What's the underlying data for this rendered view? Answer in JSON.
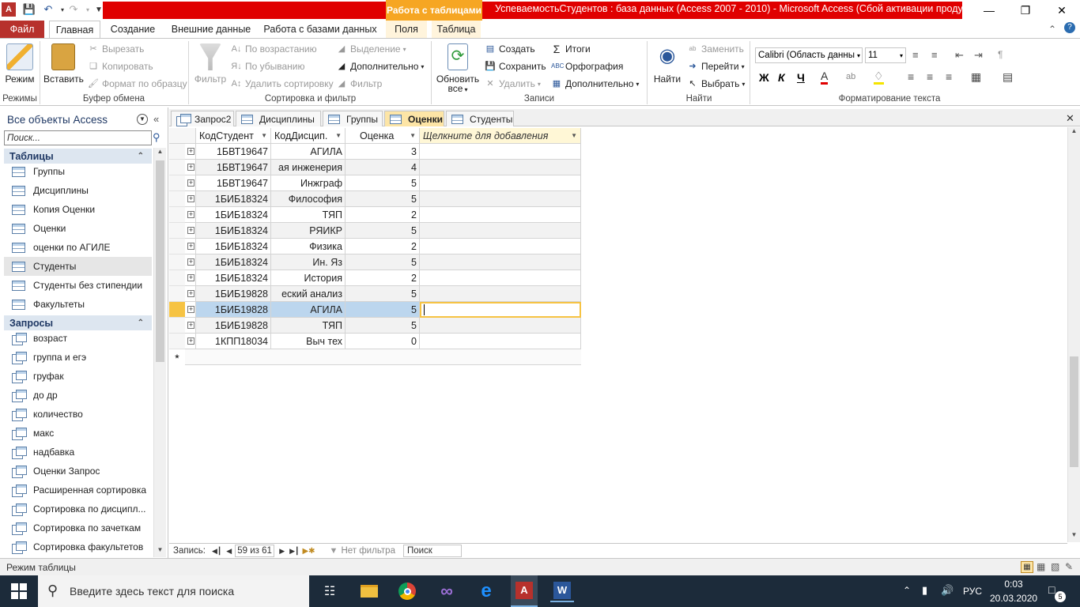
{
  "title_bar": {
    "context_tab": "Работа с таблицами",
    "window_title": "УспеваемостьСтудентов : база данных (Access 2007 - 2010)  -  Microsoft Access (Сбой активации продукта)"
  },
  "ribbon_tabs": [
    "Файл",
    "Главная",
    "Создание",
    "Внешние данные",
    "Работа с базами данных",
    "Поля",
    "Таблица"
  ],
  "ribbon": {
    "views": {
      "label": "Режимы",
      "view": "Режим"
    },
    "clipboard": {
      "label": "Буфер обмена",
      "paste": "Вставить",
      "cut": "Вырезать",
      "copy": "Копировать",
      "format_painter": "Формат по образцу"
    },
    "sort_filter": {
      "label": "Сортировка и фильтр",
      "filter": "Фильтр",
      "ascending": "По возрастанию",
      "descending": "По убыванию",
      "remove_sort": "Удалить сортировку",
      "selection": "Выделение",
      "advanced": "Дополнительно",
      "toggle_filter": "Фильтр"
    },
    "records": {
      "label": "Записи",
      "refresh": "Обновить",
      "refresh2": "все",
      "new": "Создать",
      "save": "Сохранить",
      "delete": "Удалить",
      "totals": "Итоги",
      "spelling": "Орфография",
      "more": "Дополнительно"
    },
    "find": {
      "label": "Найти",
      "find": "Найти",
      "replace": "Заменить",
      "goto": "Перейти",
      "select": "Выбрать"
    },
    "text_format": {
      "label": "Форматирование текста",
      "font": "Calibri (Область данны",
      "size": "11",
      "bold": "Ж",
      "italic": "К",
      "underline": "Ч"
    }
  },
  "nav_pane": {
    "header": "Все объекты Access",
    "search_placeholder": "Поиск...",
    "tables_label": "Таблицы",
    "tables": [
      "Группы",
      "Дисциплины",
      "Копия Оценки",
      "Оценки",
      "оценки по АГИЛЕ",
      "Студенты",
      "Студенты без стипендии",
      "Факультеты"
    ],
    "queries_label": "Запросы",
    "queries": [
      "возраст",
      "группа и егэ",
      "груфак",
      "до др",
      "количество",
      "макс",
      "надбавка",
      "Оценки Запрос",
      "Расширенная сортировка",
      "Сортировка по дисципл...",
      "Сортировка по зачеткам",
      "Сортировка факультетов"
    ]
  },
  "doc_tabs": [
    "Запрос2",
    "Дисциплины",
    "Группы",
    "Оценки",
    "Студенты"
  ],
  "datasheet": {
    "columns": [
      "КодСтудент",
      "КодДисцип.",
      "Оценка",
      "Щелкните для добавления"
    ],
    "rows": [
      [
        "1БВТ19647",
        "АГИЛА",
        "3"
      ],
      [
        "1БВТ19647",
        "ая инженерия",
        "4"
      ],
      [
        "1БВТ19647",
        "Инжграф",
        "5"
      ],
      [
        "1БИБ18324",
        "Философия",
        "5"
      ],
      [
        "1БИБ18324",
        "ТЯП",
        "2"
      ],
      [
        "1БИБ18324",
        "РЯИКР",
        "5"
      ],
      [
        "1БИБ18324",
        "Физика",
        "2"
      ],
      [
        "1БИБ18324",
        "Ин. Яз",
        "5"
      ],
      [
        "1БИБ18324",
        "История",
        "2"
      ],
      [
        "1БИБ19828",
        "еский анализ",
        "5"
      ],
      [
        "1БИБ19828",
        "АГИЛА",
        "5"
      ],
      [
        "1БИБ19828",
        "ТЯП",
        "5"
      ],
      [
        "1КПП18034",
        "Выч тех",
        "0"
      ]
    ],
    "new_row_marker": "*"
  },
  "record_nav": {
    "label": "Запись:",
    "position": "59 из 61",
    "filter": "Нет фильтра",
    "search": "Поиск"
  },
  "status_bar": {
    "mode": "Режим таблицы"
  },
  "taskbar": {
    "search_placeholder": "Введите здесь текст для поиска",
    "lang": "РУС",
    "time": "0:03",
    "date": "20.03.2020",
    "notifications": "5"
  }
}
